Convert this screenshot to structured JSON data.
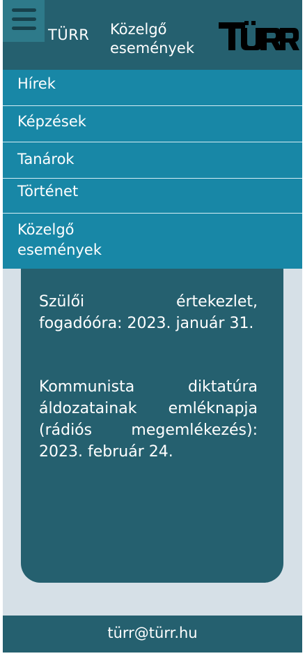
{
  "header": {
    "site_name": "TÜRR",
    "page_title": "Közelgő események",
    "logo_text": "TÜRR"
  },
  "nav": {
    "items": [
      {
        "label": "Hírek"
      },
      {
        "label": "Képzések"
      },
      {
        "label": "Tanárok"
      },
      {
        "label": "Történet"
      },
      {
        "label": "Közelgő események"
      }
    ]
  },
  "events": [
    {
      "text": "Szülői értekezlet, fogadóóra: 2023. január 31."
    },
    {
      "text": "Kommunista diktatúra áldozatainak emléknapja (rádiós megemlékezés): 2023. február 24."
    }
  ],
  "footer": {
    "email": "türr@türr.hu"
  },
  "colors": {
    "header_bg": "#25606f",
    "nav_bg": "#1887a6",
    "page_bg": "#d6e0e7"
  }
}
